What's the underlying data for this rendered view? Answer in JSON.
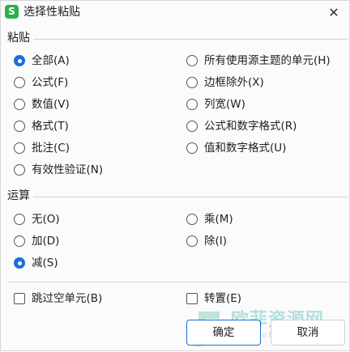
{
  "dialog": {
    "title": "选择性粘贴",
    "close_glyph": "✕",
    "app_icon_glyph": "S",
    "app_icon_color": "#2db04c"
  },
  "paste": {
    "label": "粘贴",
    "selected": "全部(A)",
    "left_options": [
      "全部(A)",
      "公式(F)",
      "数值(V)",
      "格式(T)",
      "批注(C)",
      "有效性验证(N)"
    ],
    "right_options": [
      "所有使用源主题的单元(H)",
      "边框除外(X)",
      "列宽(W)",
      "公式和数字格式(R)",
      "值和数字格式(U)"
    ]
  },
  "operation": {
    "label": "运算",
    "selected": "减(S)",
    "left_options": [
      "无(O)",
      "加(D)",
      "减(S)"
    ],
    "right_options": [
      "乘(M)",
      "除(I)"
    ]
  },
  "checkboxes": {
    "skip_blanks": "跳过空单元(B)",
    "transpose": "转置(E)"
  },
  "buttons": {
    "ok": "确定",
    "cancel": "取消"
  },
  "watermark": {
    "text": "欧菲资源网",
    "url": "www.office26.com"
  },
  "colors": {
    "accent": "#1a6ed8",
    "separator": "#d3d3d3"
  }
}
